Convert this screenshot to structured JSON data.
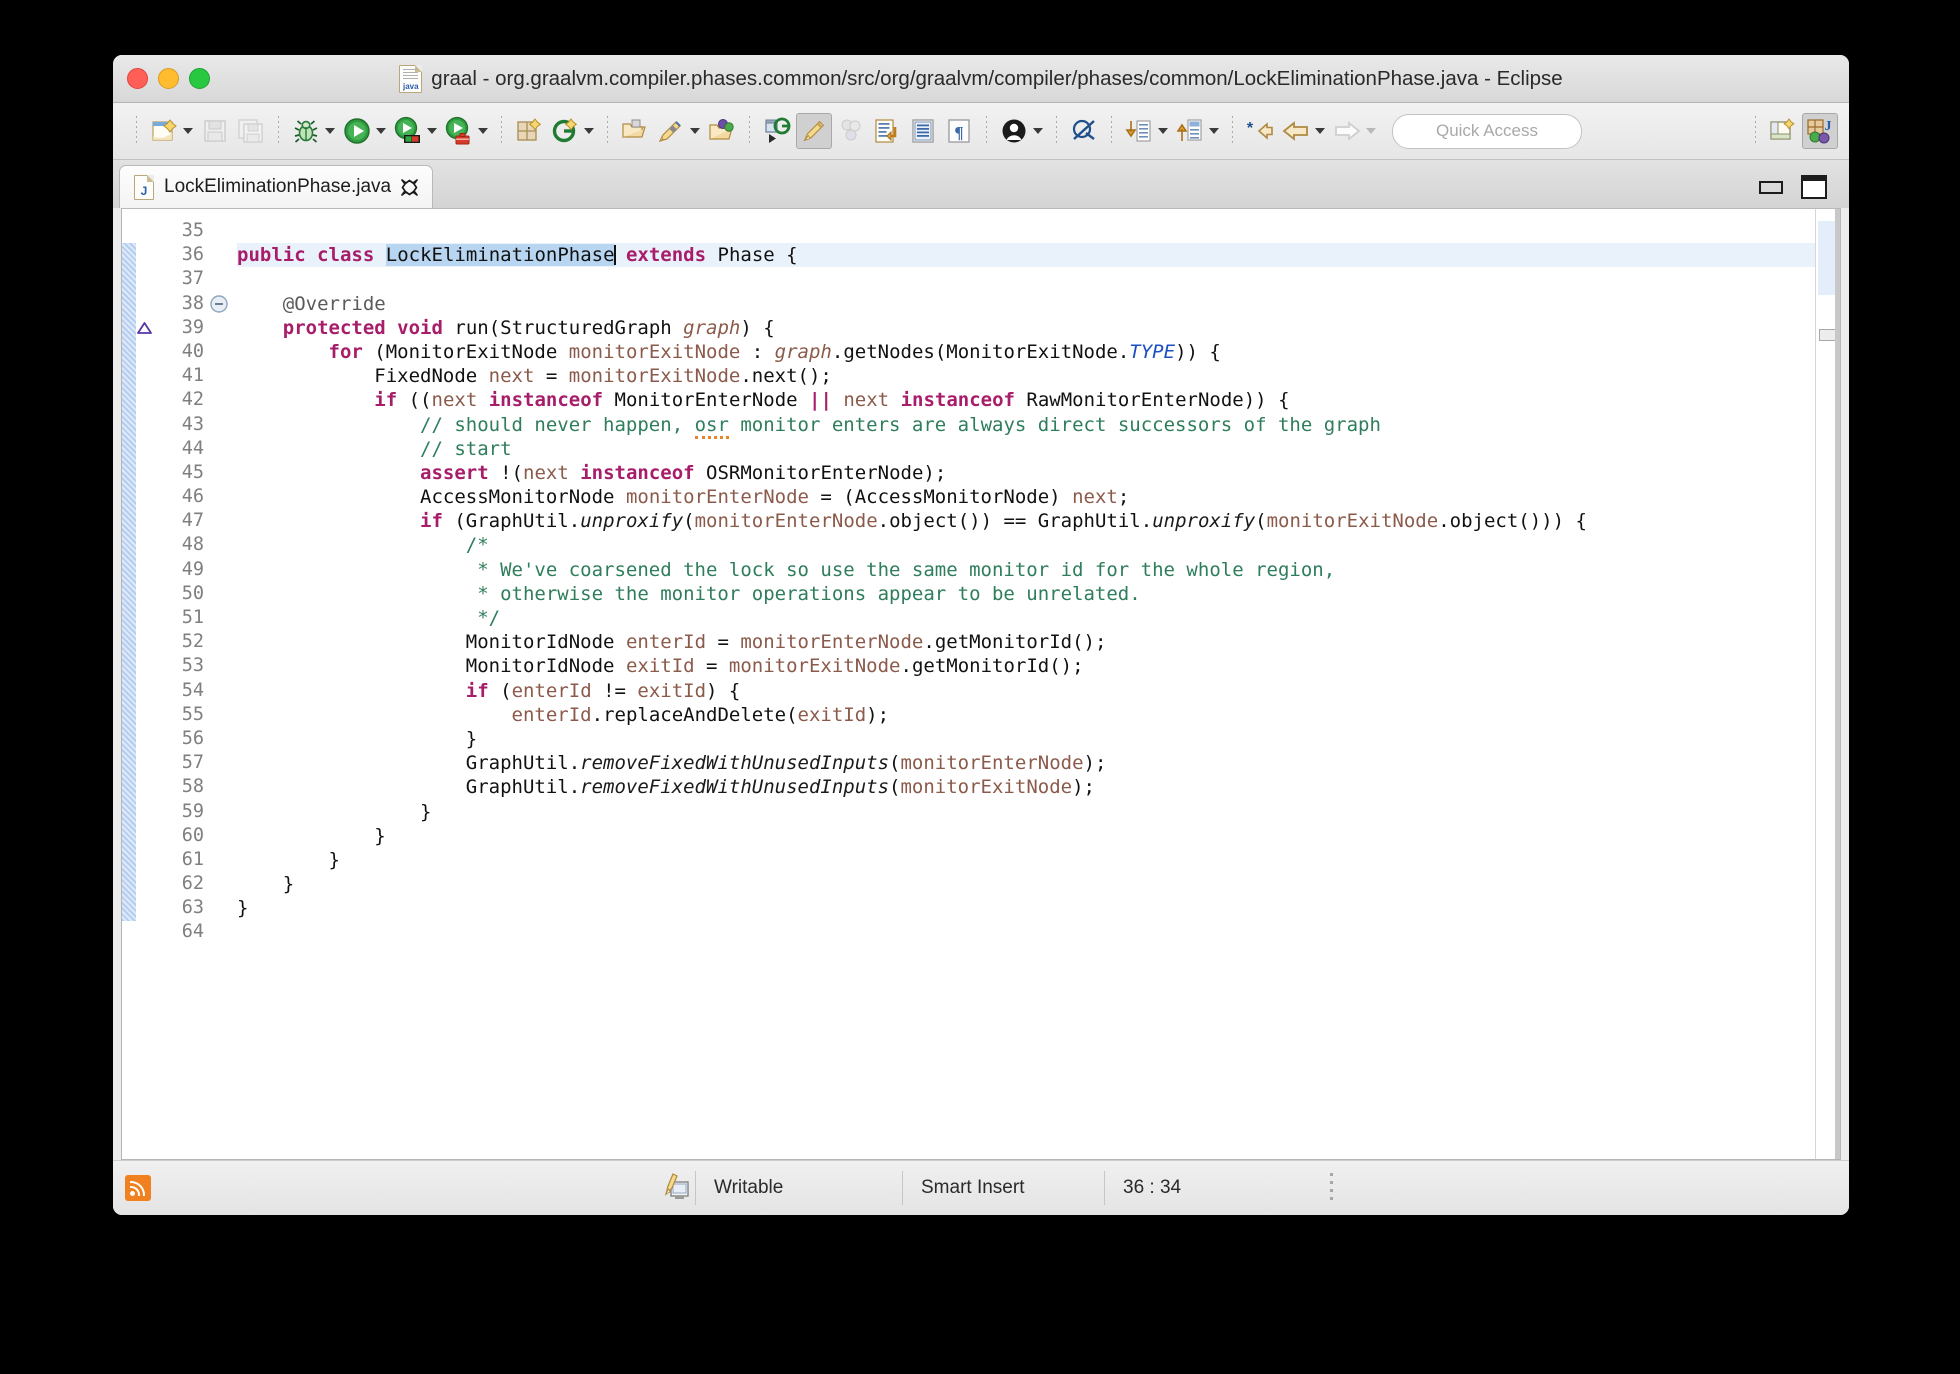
{
  "window": {
    "title": "graal - org.graalvm.compiler.phases.common/src/org/graalvm/compiler/phases/common/LockEliminationPhase.java - Eclipse",
    "file_icon": "java-file-icon",
    "controls": {
      "close": "close",
      "minimize": "minimize",
      "zoom": "zoom"
    }
  },
  "toolbar": {
    "quick_access_placeholder": "Quick Access",
    "items": [
      {
        "name": "new-wizard-button",
        "icon": "new-document-icon",
        "has_dropdown": true,
        "enabled": true
      },
      {
        "name": "save-button",
        "icon": "save-disk-icon",
        "has_dropdown": false,
        "enabled": false
      },
      {
        "name": "save-all-button",
        "icon": "save-all-disks-icon",
        "has_dropdown": false,
        "enabled": false
      },
      {
        "name": "debug-button",
        "icon": "debug-bug-icon",
        "has_dropdown": true,
        "enabled": true
      },
      {
        "name": "run-button",
        "icon": "run-play-icon",
        "has_dropdown": true,
        "enabled": true
      },
      {
        "name": "coverage-button",
        "icon": "run-coverage-icon",
        "has_dropdown": true,
        "enabled": true
      },
      {
        "name": "external-tools-button",
        "icon": "run-external-tools-icon",
        "has_dropdown": true,
        "enabled": true
      },
      {
        "name": "new-java-project-button",
        "icon": "new-java-project-icon",
        "has_dropdown": false,
        "enabled": true
      },
      {
        "name": "new-java-class-button",
        "icon": "new-java-class-icon",
        "has_dropdown": true,
        "enabled": true
      },
      {
        "name": "open-type-button",
        "icon": "open-type-folder-icon",
        "has_dropdown": false,
        "enabled": true
      },
      {
        "name": "search-button",
        "icon": "search-pen-icon",
        "has_dropdown": true,
        "enabled": true
      },
      {
        "name": "open-task-button",
        "icon": "open-task-folder-icon",
        "has_dropdown": false,
        "enabled": true
      },
      {
        "name": "skip-all-breakpoints-button",
        "icon": "skip-breakpoints-icon",
        "has_dropdown": false,
        "enabled": true
      },
      {
        "name": "toggle-mark-occurrences-button",
        "icon": "highlighter-pen-icon",
        "has_dropdown": false,
        "enabled": true,
        "pressed": true
      },
      {
        "name": "toggle-ant-build-button",
        "icon": "gray-bubbles-icon",
        "has_dropdown": false,
        "enabled": false
      },
      {
        "name": "toggle-block-selection-button",
        "icon": "block-selection-icon",
        "has_dropdown": false,
        "enabled": true
      },
      {
        "name": "show-whitespace-button",
        "icon": "whitespace-lines-icon",
        "has_dropdown": false,
        "enabled": true
      },
      {
        "name": "pilcrow-button",
        "icon": "pilcrow-icon",
        "has_dropdown": false,
        "enabled": true
      },
      {
        "name": "user-button",
        "icon": "person-circle-icon",
        "has_dropdown": true,
        "enabled": true
      },
      {
        "name": "disable-annotations-button",
        "icon": "crossed-circle-icon",
        "has_dropdown": false,
        "enabled": true
      },
      {
        "name": "pull-button",
        "icon": "pull-down-arrow-icon",
        "has_dropdown": true,
        "enabled": true
      },
      {
        "name": "push-button",
        "icon": "push-up-arrow-icon",
        "has_dropdown": true,
        "enabled": true
      },
      {
        "name": "back-star-button",
        "icon": "back-star-arrow-icon",
        "has_dropdown": false,
        "enabled": true
      },
      {
        "name": "back-button",
        "icon": "back-arrow-icon",
        "has_dropdown": true,
        "enabled": true
      },
      {
        "name": "forward-button",
        "icon": "forward-arrow-icon",
        "has_dropdown": true,
        "enabled": false
      }
    ],
    "right_items": [
      {
        "name": "open-perspective-button",
        "icon": "open-perspective-icon"
      },
      {
        "name": "perspective-java-button",
        "icon": "java-perspective-icon",
        "pressed": true
      }
    ]
  },
  "editor": {
    "tab": {
      "label": "LockEliminationPhase.java",
      "icon": "java-file-icon",
      "close_icon": "close-x-icon"
    },
    "view_buttons": {
      "minimize": "minimize-view-icon",
      "maximize": "maximize-view-icon"
    },
    "first_line": 35,
    "markers": {
      "fold_line": 38,
      "override_line": 39,
      "change_bar_from": 36,
      "change_bar_to": 63
    },
    "lines": [
      {
        "n": 35,
        "tokens": []
      },
      {
        "n": 36,
        "highlight": true,
        "tokens": [
          {
            "t": "public",
            "c": "k"
          },
          {
            "t": " "
          },
          {
            "t": "class",
            "c": "k"
          },
          {
            "t": " "
          },
          {
            "t": "LockEliminationPhase",
            "c": "sel"
          },
          {
            "t": "CURSOR",
            "c": "cursor"
          },
          {
            "t": " "
          },
          {
            "t": "extends",
            "c": "k"
          },
          {
            "t": " "
          },
          {
            "t": "Phase {"
          }
        ]
      },
      {
        "n": 37,
        "tokens": []
      },
      {
        "n": 38,
        "tokens": [
          {
            "t": "    "
          },
          {
            "t": "@Override",
            "c": "an"
          }
        ]
      },
      {
        "n": 39,
        "tokens": [
          {
            "t": "    "
          },
          {
            "t": "protected",
            "c": "k"
          },
          {
            "t": " "
          },
          {
            "t": "void",
            "c": "k"
          },
          {
            "t": " run(StructuredGraph "
          },
          {
            "t": "graph",
            "c": "pm"
          },
          {
            "t": ") {"
          }
        ]
      },
      {
        "n": 40,
        "tokens": [
          {
            "t": "        "
          },
          {
            "t": "for",
            "c": "k"
          },
          {
            "t": " (MonitorExitNode "
          },
          {
            "t": "monitorExitNode",
            "c": "lv"
          },
          {
            "t": " : "
          },
          {
            "t": "graph",
            "c": "pm"
          },
          {
            "t": ".getNodes(MonitorExitNode."
          },
          {
            "t": "TYPE",
            "c": "fld"
          },
          {
            "t": ")) {"
          }
        ]
      },
      {
        "n": 41,
        "tokens": [
          {
            "t": "            FixedNode "
          },
          {
            "t": "next",
            "c": "lv"
          },
          {
            "t": " = "
          },
          {
            "t": "monitorExitNode",
            "c": "lv"
          },
          {
            "t": ".next();"
          }
        ]
      },
      {
        "n": 42,
        "tokens": [
          {
            "t": "            "
          },
          {
            "t": "if",
            "c": "k"
          },
          {
            "t": " (("
          },
          {
            "t": "next",
            "c": "lv"
          },
          {
            "t": " "
          },
          {
            "t": "instanceof",
            "c": "k"
          },
          {
            "t": " MonitorEnterNode "
          },
          {
            "t": "||",
            "c": "k"
          },
          {
            "t": " "
          },
          {
            "t": "next",
            "c": "lv"
          },
          {
            "t": " "
          },
          {
            "t": "instanceof",
            "c": "k"
          },
          {
            "t": " RawMonitorEnterNode)) {"
          }
        ]
      },
      {
        "n": 43,
        "tokens": [
          {
            "t": "                "
          },
          {
            "t": "// should never happen, ",
            "c": "cm"
          },
          {
            "t": "osr",
            "c": "cm spell"
          },
          {
            "t": " monitor enters are always direct successors of the graph",
            "c": "cm"
          }
        ]
      },
      {
        "n": 44,
        "tokens": [
          {
            "t": "                "
          },
          {
            "t": "// start",
            "c": "cm"
          }
        ]
      },
      {
        "n": 45,
        "tokens": [
          {
            "t": "                "
          },
          {
            "t": "assert",
            "c": "k"
          },
          {
            "t": " !("
          },
          {
            "t": "next",
            "c": "lv"
          },
          {
            "t": " "
          },
          {
            "t": "instanceof",
            "c": "k"
          },
          {
            "t": " OSRMonitorEnterNode);"
          }
        ]
      },
      {
        "n": 46,
        "tokens": [
          {
            "t": "                AccessMonitorNode "
          },
          {
            "t": "monitorEnterNode",
            "c": "lv"
          },
          {
            "t": " = (AccessMonitorNode) "
          },
          {
            "t": "next",
            "c": "lv"
          },
          {
            "t": ";"
          }
        ]
      },
      {
        "n": 47,
        "tokens": [
          {
            "t": "                "
          },
          {
            "t": "if",
            "c": "k"
          },
          {
            "t": " (GraphUtil."
          },
          {
            "t": "unproxify",
            "c": "sm"
          },
          {
            "t": "("
          },
          {
            "t": "monitorEnterNode",
            "c": "lv"
          },
          {
            "t": ".object()) == GraphUtil."
          },
          {
            "t": "unproxify",
            "c": "sm"
          },
          {
            "t": "("
          },
          {
            "t": "monitorExitNode",
            "c": "lv"
          },
          {
            "t": ".object())) {"
          }
        ]
      },
      {
        "n": 48,
        "tokens": [
          {
            "t": "                    "
          },
          {
            "t": "/*",
            "c": "cm"
          }
        ]
      },
      {
        "n": 49,
        "tokens": [
          {
            "t": "                     "
          },
          {
            "t": "* We've coarsened the lock so use the same monitor id for the whole region,",
            "c": "cm"
          }
        ]
      },
      {
        "n": 50,
        "tokens": [
          {
            "t": "                     "
          },
          {
            "t": "* otherwise the monitor operations appear to be unrelated.",
            "c": "cm"
          }
        ]
      },
      {
        "n": 51,
        "tokens": [
          {
            "t": "                     "
          },
          {
            "t": "*/",
            "c": "cm"
          }
        ]
      },
      {
        "n": 52,
        "tokens": [
          {
            "t": "                    MonitorIdNode "
          },
          {
            "t": "enterId",
            "c": "lv"
          },
          {
            "t": " = "
          },
          {
            "t": "monitorEnterNode",
            "c": "lv"
          },
          {
            "t": ".getMonitorId();"
          }
        ]
      },
      {
        "n": 53,
        "tokens": [
          {
            "t": "                    MonitorIdNode "
          },
          {
            "t": "exitId",
            "c": "lv"
          },
          {
            "t": " = "
          },
          {
            "t": "monitorExitNode",
            "c": "lv"
          },
          {
            "t": ".getMonitorId();"
          }
        ]
      },
      {
        "n": 54,
        "tokens": [
          {
            "t": "                    "
          },
          {
            "t": "if",
            "c": "k"
          },
          {
            "t": " ("
          },
          {
            "t": "enterId",
            "c": "lv"
          },
          {
            "t": " != "
          },
          {
            "t": "exitId",
            "c": "lv"
          },
          {
            "t": ") {"
          }
        ]
      },
      {
        "n": 55,
        "tokens": [
          {
            "t": "                        "
          },
          {
            "t": "enterId",
            "c": "lv"
          },
          {
            "t": ".replaceAndDelete("
          },
          {
            "t": "exitId",
            "c": "lv"
          },
          {
            "t": ");"
          }
        ]
      },
      {
        "n": 56,
        "tokens": [
          {
            "t": "                    }"
          }
        ]
      },
      {
        "n": 57,
        "tokens": [
          {
            "t": "                    GraphUtil."
          },
          {
            "t": "removeFixedWithUnusedInputs",
            "c": "sm"
          },
          {
            "t": "("
          },
          {
            "t": "monitorEnterNode",
            "c": "lv"
          },
          {
            "t": ");"
          }
        ]
      },
      {
        "n": 58,
        "tokens": [
          {
            "t": "                    GraphUtil."
          },
          {
            "t": "removeFixedWithUnusedInputs",
            "c": "sm"
          },
          {
            "t": "("
          },
          {
            "t": "monitorExitNode",
            "c": "lv"
          },
          {
            "t": ");"
          }
        ]
      },
      {
        "n": 59,
        "tokens": [
          {
            "t": "                }"
          }
        ]
      },
      {
        "n": 60,
        "tokens": [
          {
            "t": "            }"
          }
        ]
      },
      {
        "n": 61,
        "tokens": [
          {
            "t": "        }"
          }
        ]
      },
      {
        "n": 62,
        "tokens": [
          {
            "t": "    }"
          }
        ]
      },
      {
        "n": 63,
        "tokens": [
          {
            "t": "}"
          }
        ]
      },
      {
        "n": 64,
        "tokens": []
      }
    ]
  },
  "statusbar": {
    "rss_icon": "rss-feed-icon",
    "writing_icon": "writable-pen-icon",
    "writable": "Writable",
    "insert_mode": "Smart Insert",
    "cursor_position": "36 : 34"
  },
  "colors": {
    "keyword": "#a81d6a",
    "comment": "#2e7d5b",
    "local_variable": "#8b5a4a",
    "static_field": "#1a4fc4",
    "selection": "#b8d6f2",
    "line_highlight": "#e9f1fb",
    "spellcheck": "#e8852a",
    "change_bar": "#b4cdf0"
  }
}
